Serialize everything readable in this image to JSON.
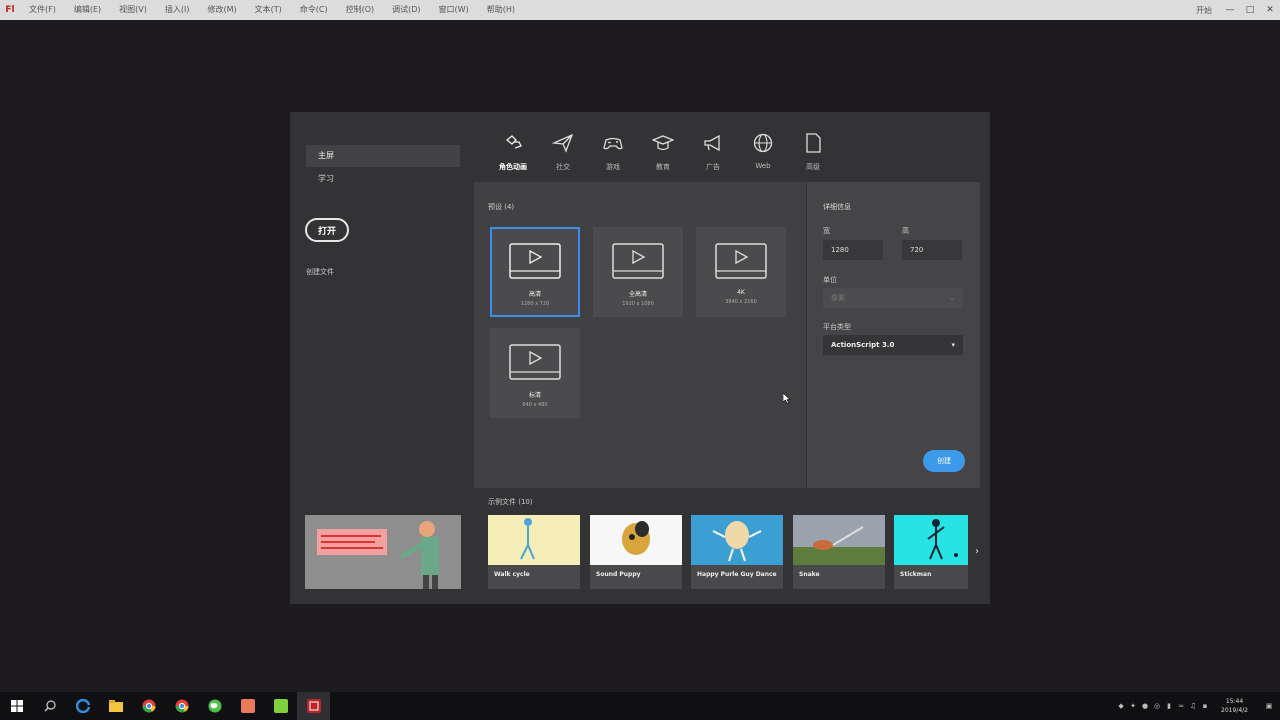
{
  "menubar": {
    "logo": "Fl",
    "items": [
      "文件(F)",
      "编辑(E)",
      "视图(V)",
      "插入(I)",
      "修改(M)",
      "文本(T)",
      "命令(C)",
      "控制(O)",
      "调试(D)",
      "窗口(W)",
      "帮助(H)"
    ],
    "workspace": "开始",
    "buttons": [
      "—",
      "□",
      "✕"
    ]
  },
  "dialog": {
    "sidebar": {
      "home": "主屏",
      "learn": "学习",
      "open": "打开",
      "new_file": "创建文件"
    },
    "tabs": [
      "角色动画",
      "社交",
      "游戏",
      "教育",
      "广告",
      "Web",
      "高级"
    ],
    "presets_title": "预设 (4)",
    "presets": [
      {
        "name": "高清",
        "size": "1280 x 720"
      },
      {
        "name": "全高清",
        "size": "1920 x 1080"
      },
      {
        "name": "4K",
        "size": "3840 x 2160"
      },
      {
        "name": "标清",
        "size": "640 x 480"
      }
    ],
    "details": {
      "title": "详细信息",
      "width_label": "宽",
      "height_label": "高",
      "width": "1280",
      "height": "720",
      "units_label": "单位",
      "units": "像素",
      "platform_label": "平台类型",
      "platform": "ActionScript 3.0",
      "create": "创建"
    },
    "samples_title": "示例文件 (10)",
    "samples": [
      "Walk cycle",
      "Sound Puppy",
      "Happy Purle Guy Dance",
      "Snake",
      "Stickman"
    ]
  },
  "taskbar": {
    "clock_time": "15:44",
    "clock_date": "2019/4/2"
  }
}
